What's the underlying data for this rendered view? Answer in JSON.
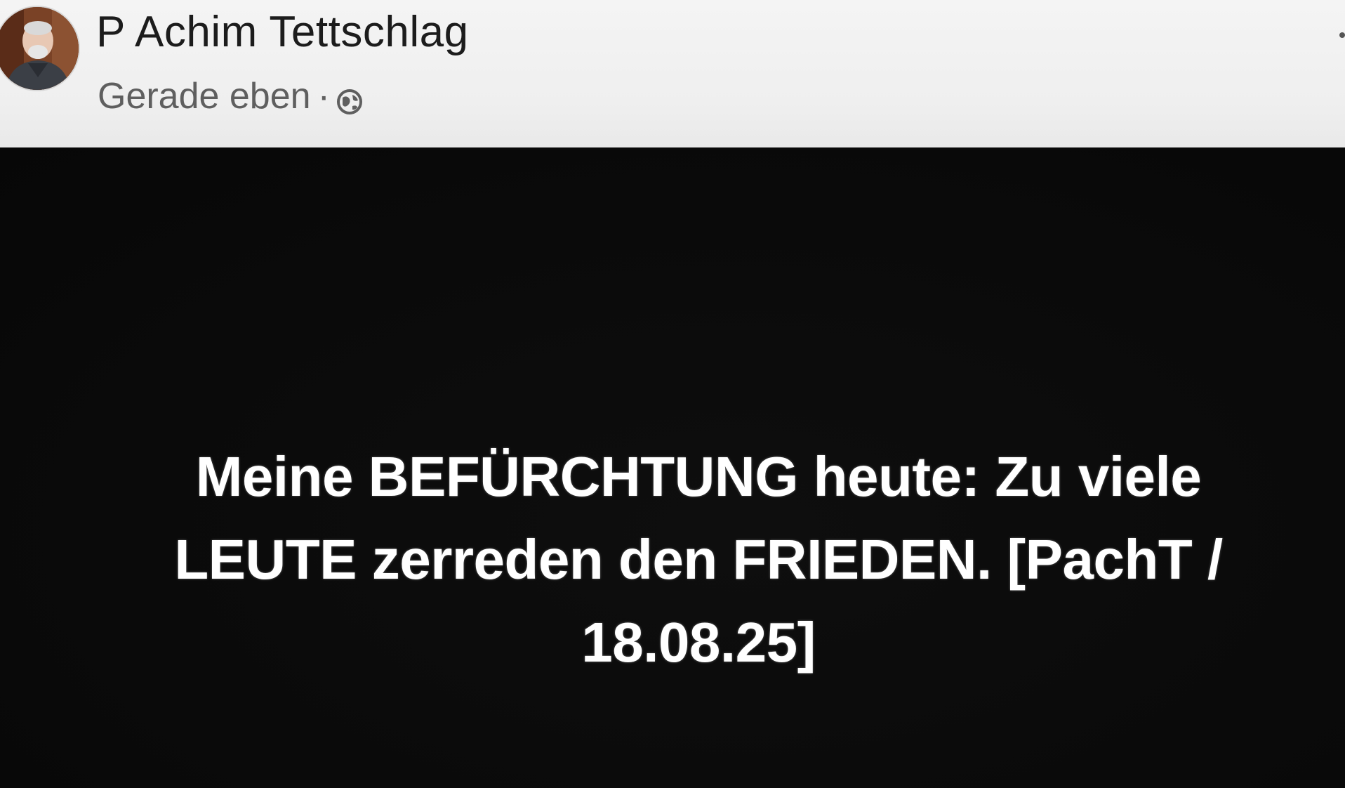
{
  "post": {
    "author_name": "P Achim Tettschlag",
    "timestamp": "Gerade eben",
    "separator": "·",
    "privacy_icon": "globe-icon",
    "content_text": "Meine BEFÜRCHTUNG heute: Zu viele LEUTE zerreden den FRIEDEN. [PachT / 18.08.25]",
    "background_color": "#0c0c0c",
    "text_color": "#ffffff"
  }
}
